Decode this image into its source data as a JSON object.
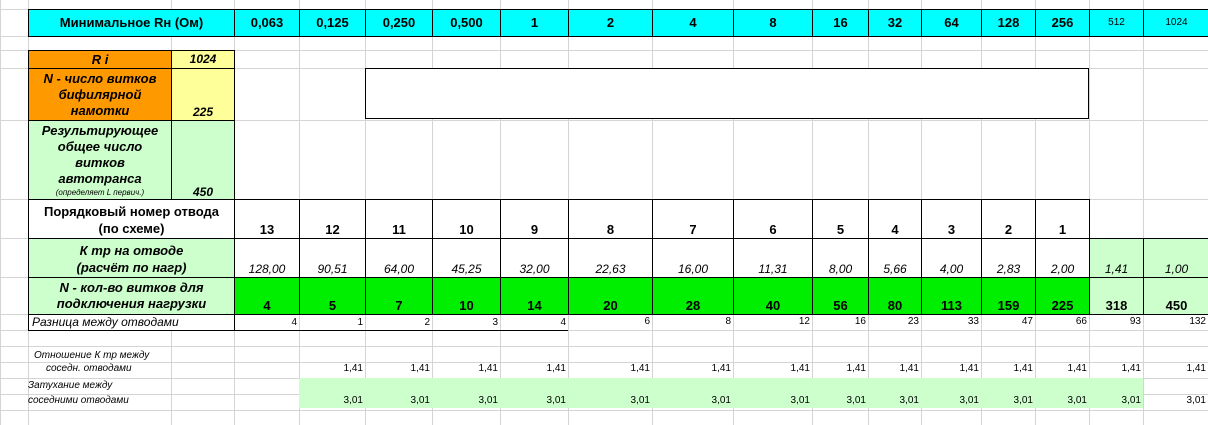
{
  "header": {
    "label": "Минимальное Rн (Ом)",
    "values": [
      "0,063",
      "0,125",
      "0,250",
      "0,500",
      "1",
      "2",
      "4",
      "8",
      "16",
      "32",
      "64",
      "128",
      "256",
      "512",
      "1024"
    ]
  },
  "params": {
    "ri_label": "R i",
    "ri_value": "1024",
    "n_label_1": "N - число витков",
    "n_label_2": "бифилярной",
    "n_label_3": "намотки",
    "n_value": "225",
    "res_label_1": "Результирующее",
    "res_label_2": "общее число",
    "res_label_3": "витков",
    "res_label_4": "автотранса",
    "res_note": "(определяет L первич.)",
    "res_value": "450"
  },
  "tap_row": {
    "label_1": "Порядковый номер отвода",
    "label_2": "(по схеме)",
    "values": [
      "13",
      "12",
      "11",
      "10",
      "9",
      "8",
      "7",
      "6",
      "5",
      "4",
      "3",
      "2",
      "1"
    ]
  },
  "ktr_row": {
    "label_1": "К тр на отводе",
    "label_2": "(расчёт по нагр)",
    "values": [
      "128,00",
      "90,51",
      "64,00",
      "45,25",
      "32,00",
      "22,63",
      "16,00",
      "11,31",
      "8,00",
      "5,66",
      "4,00",
      "2,83",
      "2,00",
      "1,41",
      "1,00"
    ]
  },
  "turns_row": {
    "label_1": "N - кол-во витков для",
    "label_2": "подключения нагрузки",
    "values": [
      "4",
      "5",
      "7",
      "10",
      "14",
      "20",
      "28",
      "40",
      "56",
      "80",
      "113",
      "159",
      "225",
      "318",
      "450"
    ]
  },
  "diff_row": {
    "label": "Разница между отводами",
    "values": [
      "4",
      "1",
      "2",
      "3",
      "4",
      "6",
      "8",
      "12",
      "16",
      "23",
      "33",
      "47",
      "66",
      "93",
      "132"
    ]
  },
  "ratio_row": {
    "label_1": "Отношение К тр между",
    "label_2": "соседн. отводами",
    "values": [
      "1,41",
      "1,41",
      "1,41",
      "1,41",
      "1,41",
      "1,41",
      "1,41",
      "1,41",
      "1,41",
      "1,41",
      "1,41",
      "1,41",
      "1,41",
      "1,41",
      "1,41"
    ]
  },
  "atten_row": {
    "label_1": "Затухание между",
    "label_2": "соседними отводами",
    "values": [
      "3,01",
      "3,01",
      "3,01",
      "3,01",
      "3,01",
      "3,01",
      "3,01",
      "3,01",
      "3,01",
      "3,01",
      "3,01",
      "3,01",
      "3,01",
      "3,01",
      "3,01"
    ]
  },
  "colors": {
    "header_cyan": "#00ffff",
    "orange": "#ff9900",
    "yellow": "#ffff99",
    "light_green": "#ccffcc",
    "green": "#00ee00"
  }
}
